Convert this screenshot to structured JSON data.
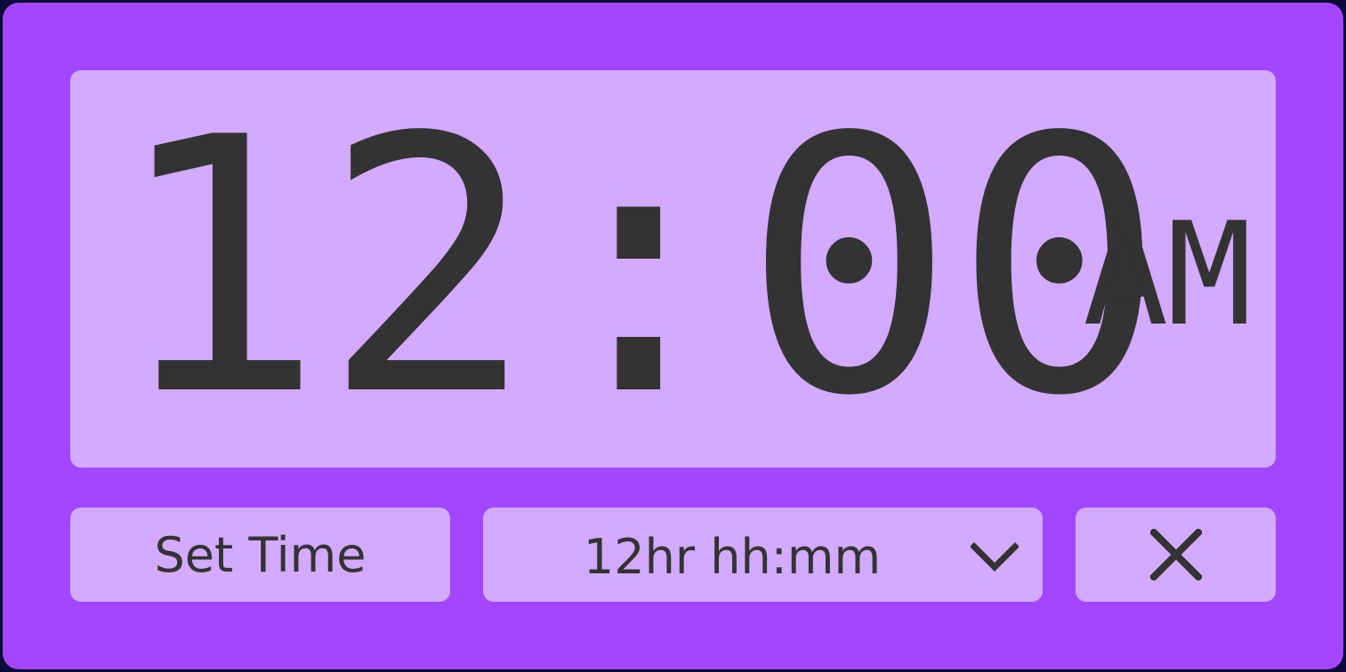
{
  "clock": {
    "time": "12:00",
    "meridiem": "AM"
  },
  "controls": {
    "set_time_label": "Set Time",
    "format_select": {
      "selected": "12hr hh:mm"
    },
    "close_icon": "close-icon",
    "dropdown_icon": "chevron-down-icon"
  },
  "colors": {
    "window_bg": "#a247ff",
    "panel_bg": "#d3aaff",
    "text": "#333333",
    "outer_border": "#0b0a3a"
  }
}
